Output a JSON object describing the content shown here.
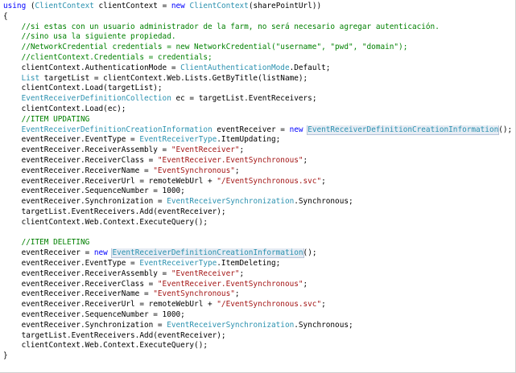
{
  "editor": {
    "lines": [
      [
        [
          "keyword",
          "using"
        ],
        [
          "plain",
          " ("
        ],
        [
          "type",
          "ClientContext"
        ],
        [
          "plain",
          " clientContext = "
        ],
        [
          "keyword",
          "new"
        ],
        [
          "plain",
          " "
        ],
        [
          "type",
          "ClientContext"
        ],
        [
          "plain",
          "(sharePointUrl))"
        ]
      ],
      [
        [
          "plain",
          "{"
        ]
      ],
      [
        [
          "comment",
          "    //si estas con un usuario administrador de la farm, no será necesario agregar autenticación."
        ]
      ],
      [
        [
          "comment",
          "    //sino usa la siguiente propiedad."
        ]
      ],
      [
        [
          "comment",
          "    //NetworkCredential credentials = new NetworkCredential(\"username\", \"pwd\", \"domain\");"
        ]
      ],
      [
        [
          "comment",
          "    //clientContext.Credentials = credentials;"
        ]
      ],
      [
        [
          "plain",
          "    clientContext.AuthenticationMode = "
        ],
        [
          "type",
          "ClientAuthenticationMode"
        ],
        [
          "plain",
          ".Default;"
        ]
      ],
      [
        [
          "plain",
          "    "
        ],
        [
          "type",
          "List"
        ],
        [
          "plain",
          " targetList = clientContext.Web.Lists.GetByTitle(listName);"
        ]
      ],
      [
        [
          "plain",
          "    clientContext.Load(targetList);"
        ]
      ],
      [
        [
          "plain",
          "    "
        ],
        [
          "type",
          "EventReceiverDefinitionCollection"
        ],
        [
          "plain",
          " ec = targetList.EventReceivers;"
        ]
      ],
      [
        [
          "plain",
          "    clientContext.Load(ec);"
        ]
      ],
      [
        [
          "comment",
          "    //ITEM UPDATING"
        ]
      ],
      [
        [
          "plain",
          "    "
        ],
        [
          "type",
          "EventReceiverDefinitionCreationInformation"
        ],
        [
          "plain",
          " eventReceiver = "
        ],
        [
          "keyword",
          "new"
        ],
        [
          "plain",
          " "
        ],
        [
          "highlight",
          "EventReceiverDefinitionCreationInformation"
        ],
        [
          "plain",
          "();"
        ]
      ],
      [
        [
          "plain",
          "    eventReceiver.EventType = "
        ],
        [
          "type",
          "EventReceiverType"
        ],
        [
          "plain",
          ".ItemUpdating;"
        ]
      ],
      [
        [
          "plain",
          "    eventReceiver.ReceiverAssembly = "
        ],
        [
          "string",
          "\"EventReceiver\""
        ],
        [
          "plain",
          ";"
        ]
      ],
      [
        [
          "plain",
          "    eventReceiver.ReceiverClass = "
        ],
        [
          "string",
          "\"EventReceiver.EventSynchronous\""
        ],
        [
          "plain",
          ";"
        ]
      ],
      [
        [
          "plain",
          "    eventReceiver.ReceiverName = "
        ],
        [
          "string",
          "\"EventSynchronous\""
        ],
        [
          "plain",
          ";"
        ]
      ],
      [
        [
          "plain",
          "    eventReceiver.ReceiverUrl = remoteWebUrl + "
        ],
        [
          "string",
          "\"/EventSynchronous.svc\""
        ],
        [
          "plain",
          ";"
        ]
      ],
      [
        [
          "plain",
          "    eventReceiver.SequenceNumber = 1000;"
        ]
      ],
      [
        [
          "plain",
          "    eventReceiver.Synchronization = "
        ],
        [
          "type",
          "EventReceiverSynchronization"
        ],
        [
          "plain",
          ".Synchronous;"
        ]
      ],
      [
        [
          "plain",
          "    targetList.EventReceivers.Add(eventReceiver);"
        ]
      ],
      [
        [
          "plain",
          "    clientContext.Web.Context.ExecuteQuery();"
        ]
      ],
      [
        [
          "plain",
          ""
        ]
      ],
      [
        [
          "comment",
          "    //ITEM DELETING"
        ]
      ],
      [
        [
          "plain",
          "    eventReceiver = "
        ],
        [
          "keyword",
          "new"
        ],
        [
          "plain",
          " "
        ],
        [
          "highlight",
          "EventReceiverDefinitionCreationInformation"
        ],
        [
          "plain",
          "();"
        ]
      ],
      [
        [
          "plain",
          "    eventReceiver.EventType = "
        ],
        [
          "type",
          "EventReceiverType"
        ],
        [
          "plain",
          ".ItemDeleting;"
        ]
      ],
      [
        [
          "plain",
          "    eventReceiver.ReceiverAssembly = "
        ],
        [
          "string",
          "\"EventReceiver\""
        ],
        [
          "plain",
          ";"
        ]
      ],
      [
        [
          "plain",
          "    eventReceiver.ReceiverClass = "
        ],
        [
          "string",
          "\"EventReceiver.EventSynchronous\""
        ],
        [
          "plain",
          ";"
        ]
      ],
      [
        [
          "plain",
          "    eventReceiver.ReceiverName = "
        ],
        [
          "string",
          "\"EventSynchronous\""
        ],
        [
          "plain",
          ";"
        ]
      ],
      [
        [
          "plain",
          "    eventReceiver.ReceiverUrl = remoteWebUrl + "
        ],
        [
          "string",
          "\"/EventSynchronous.svc\""
        ],
        [
          "plain",
          ";"
        ]
      ],
      [
        [
          "plain",
          "    eventReceiver.SequenceNumber = 1000;"
        ]
      ],
      [
        [
          "plain",
          "    eventReceiver.Synchronization = "
        ],
        [
          "type",
          "EventReceiverSynchronization"
        ],
        [
          "plain",
          ".Synchronous;"
        ]
      ],
      [
        [
          "plain",
          "    targetList.EventReceivers.Add(eventReceiver);"
        ]
      ],
      [
        [
          "plain",
          "    clientContext.Web.Context.ExecuteQuery();"
        ]
      ],
      [
        [
          "plain",
          "}"
        ]
      ]
    ],
    "colors": {
      "keyword": "#0000ff",
      "type": "#2b91af",
      "string": "#a31515",
      "comment": "#008000",
      "plain": "#000000",
      "highlight_background": "#e6ecf4"
    }
  }
}
